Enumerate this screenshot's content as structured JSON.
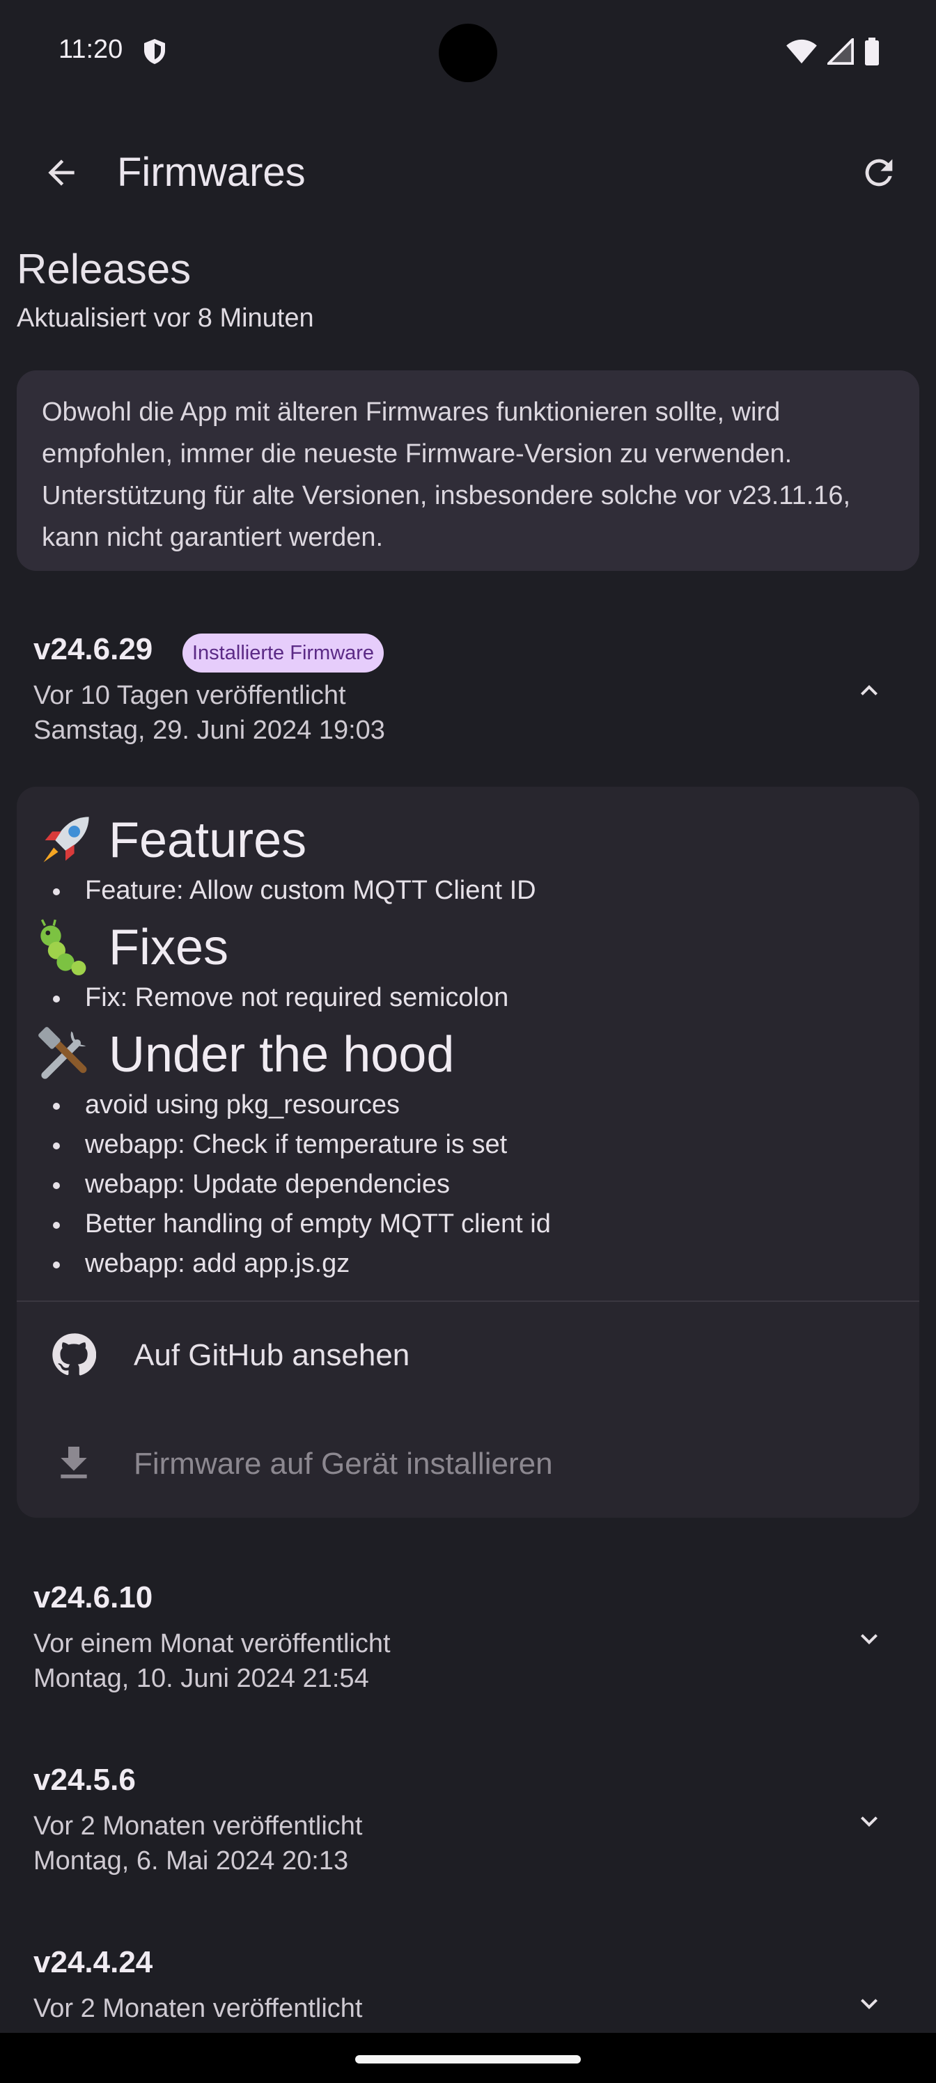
{
  "status_bar": {
    "time": "11:20"
  },
  "app_bar": {
    "title": "Firmwares"
  },
  "section": {
    "title": "Releases",
    "updated": "Aktualisiert vor 8 Minuten"
  },
  "notice": {
    "text": "Obwohl die App mit älteren Firmwares funktionieren sollte, wird empfohlen, immer die neueste Firmware-Version zu verwenden. Unterstützung für alte Versionen, insbesondere solche vor v23.11.16, kann nicht garantiert werden."
  },
  "releases": [
    {
      "version": "v24.6.29",
      "badge": "Installierte Firmware",
      "relative": "Vor 10 Tagen veröffentlicht",
      "date": "Samstag, 29. Juni 2024 19:03",
      "expanded": true
    },
    {
      "version": "v24.6.10",
      "relative": "Vor einem Monat veröffentlicht",
      "date": "Montag, 10. Juni 2024 21:54",
      "expanded": false
    },
    {
      "version": "v24.5.6",
      "relative": "Vor 2 Monaten veröffentlicht",
      "date": "Montag, 6. Mai 2024 20:13",
      "expanded": false
    },
    {
      "version": "v24.4.24",
      "relative": "Vor 2 Monaten veröffentlicht",
      "date": "",
      "expanded": false
    }
  ],
  "notes": {
    "features": {
      "title": "Features",
      "emoji": "rocket-icon",
      "items": [
        "Feature: Allow custom MQTT Client ID"
      ]
    },
    "fixes": {
      "title": "Fixes",
      "emoji": "caterpillar-icon",
      "items": [
        "Fix: Remove not required semicolon"
      ]
    },
    "hood": {
      "title": "Under the hood",
      "emoji": "hammer-wrench-icon",
      "items": [
        "avoid using pkg_resources",
        "webapp: Check if temperature is set",
        "webapp: Update dependencies",
        "Better handling of empty MQTT client id",
        "webapp: add app.js.gz"
      ]
    }
  },
  "actions": {
    "github": "Auf GitHub ansehen",
    "install": "Firmware auf Gerät installieren"
  },
  "colors": {
    "background": "#1e1e24",
    "card": "#28262e",
    "notice": "#302d38",
    "badge_bg": "#e6cdfb",
    "badge_text": "#5b2a86",
    "disabled_text": "#8c8890"
  }
}
